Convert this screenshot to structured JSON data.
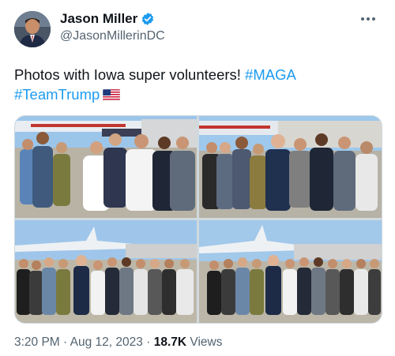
{
  "author": {
    "name": "Jason Miller",
    "handle": "@JasonMillerinDC",
    "verified": true
  },
  "tweet": {
    "text": "Photos with Iowa super volunteers!",
    "hashtag1": "#MAGA",
    "hashtag2": "#TeamTrump",
    "emoji": "us-flag-icon"
  },
  "meta": {
    "time": "3:20 PM",
    "separator": "·",
    "date": "Aug 12, 2023",
    "views_count": "18.7K",
    "views_label": "Views"
  },
  "colors": {
    "accent": "#1d9bf0",
    "text": "#0f1419",
    "muted": "#536471"
  }
}
